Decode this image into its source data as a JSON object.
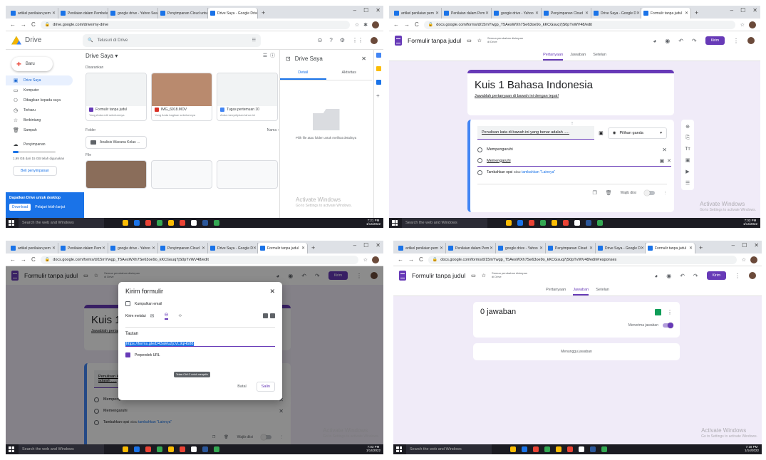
{
  "tabs_q1": [
    "artikel penilaian pem",
    "Penilaian dalam Pembelajar",
    "google drive - Yahoo Search",
    "Penyimpanan Cloud untuk",
    "Drive Saya - Google Drive"
  ],
  "tabs_q2": [
    "artikel penilaian pem",
    "Penilaian dalam Pem",
    "google drive - Yahoo",
    "Penyimpanan Cloud",
    "Drive Saya - Google D",
    "Formulir tanpa judul"
  ],
  "urls": {
    "drive": "drive.google.com/drive/my-drive",
    "form_edit": "docs.google.com/forms/d/15mYwgp_T5AesWXh7Se63oe9o_kKCGsuq7jS0pTvWV48/edit",
    "form_resp": "docs.google.com/forms/d/15mYwgp_T5AesWXh7Se63oe9o_kKCGsuq7jS0pTvWV48/edit#responses"
  },
  "drive": {
    "app_name": "Drive",
    "search_placeholder": "Telusuri di Drive",
    "new_label": "Baru",
    "sidebar": [
      {
        "label": "Drive Saya",
        "icon": "drive-icon"
      },
      {
        "label": "Komputer",
        "icon": "computer-icon"
      },
      {
        "label": "Dibagikan kepada saya",
        "icon": "people-icon"
      },
      {
        "label": "Terbaru",
        "icon": "clock-icon"
      },
      {
        "label": "Berbintang",
        "icon": "star-icon"
      },
      {
        "label": "Sampah",
        "icon": "trash-icon"
      },
      {
        "label": "Penyimpanan",
        "icon": "cloud-icon"
      }
    ],
    "storage_text": "1,99 GB dari 15 GB telah digunakan",
    "storage_fraction": 0.13,
    "buy_storage": "Beli penyimpanan",
    "promo_title": "Dapatkan Drive untuk desktop",
    "promo_download": "Download",
    "promo_more": "Pelajari lebih lanjut",
    "main_title": "Drive Saya",
    "suggested_label": "Disarankan",
    "cards": [
      {
        "name": "Formulir tanpa judul",
        "sub": "Yang Anda edit sebelumnya",
        "color": "#673ab7"
      },
      {
        "name": "IMG_6918.MOV",
        "sub": "Yang Anda bagikan sebelumnya",
        "color": "#d93025"
      },
      {
        "name": "Tugas pertemuan 10",
        "sub": "Anda menyelipkan tahun ini",
        "color": "#4285f4"
      }
    ],
    "folder_label": "Folder",
    "name_sort": "Nama ↑",
    "folder_name": "Analisis Wacana Kelas ...",
    "file_label": "File",
    "panel_title": "Drive Saya",
    "panel_tab_detail": "Detail",
    "panel_tab_activity": "Aktivitas",
    "panel_message": "Pilih file atau folder untuk melihat detailnya"
  },
  "form": {
    "title": "Formulir tanpa judul",
    "saved_line1": "Semua perubahan disimpan",
    "saved_line2": "di Drive",
    "send_label": "Kirim",
    "tab_questions": "Pertanyaan",
    "tab_answers": "Jawaban",
    "tab_settings": "Setelan",
    "form_title": "Kuis 1 Bahasa Indonesia",
    "form_desc": "Jawablah pertanyaan di bawah ini dengan tepat!",
    "question": "Penulisan kata di bawah ini yang benar adalah .....",
    "question_type": "Pilihan ganda",
    "option1": "Mempengaruhi",
    "option2": "Memengaruhi",
    "add_option": "Tambahkan opsi",
    "or_word": "atau",
    "add_other": "tambahkan \"Lainnya\"",
    "required_label": "Wajib diisi"
  },
  "dialog": {
    "title": "Kirim formulir",
    "collect_email": "Kumpulkan email",
    "send_via": "Kirim melalui",
    "link_label": "Tautan",
    "link_value": "https://forms.gle/D43aMu2jcVL9qHb88",
    "shorten_url": "Perpendek URL",
    "tooltip": "Tekan Ctrl+C untuk menyalin",
    "cancel": "Batal",
    "copy": "Salin"
  },
  "responses": {
    "count": "0 jawaban",
    "accepting": "Menerima jawaban",
    "waiting": "Menunggu jawaban"
  },
  "taskbar": {
    "search": "Search the web and Windows",
    "times": [
      "7:21 PM",
      "7:03 PM",
      "7:03 PM",
      "7:18 PM"
    ],
    "date": "1/14/2022"
  },
  "watermark": {
    "title": "Activate Windows",
    "sub": "Go to Settings to activate Windows."
  }
}
